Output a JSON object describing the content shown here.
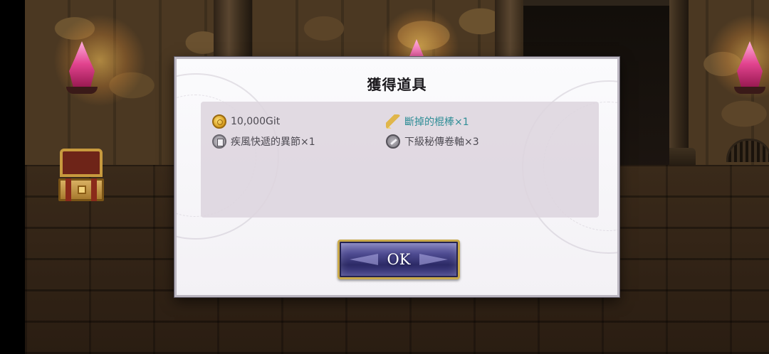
{
  "dialog": {
    "title": "獲得道具",
    "ok_label": "OK"
  },
  "items": [
    {
      "label": "10,000Git",
      "icon": "coin-icon",
      "highlight": false
    },
    {
      "label": "斷掉的棍棒×1",
      "icon": "stick-icon",
      "highlight": true
    },
    {
      "label": "疾風快遞的異節×1",
      "icon": "book-icon",
      "highlight": false
    },
    {
      "label": "下級秘傳卷軸×3",
      "icon": "scroll-icon",
      "highlight": false
    }
  ],
  "colors": {
    "highlight_text": "#2f8d96",
    "normal_text": "#4d4a52",
    "button_gold": "#c9a94a",
    "button_purple": "#4d4a90"
  }
}
